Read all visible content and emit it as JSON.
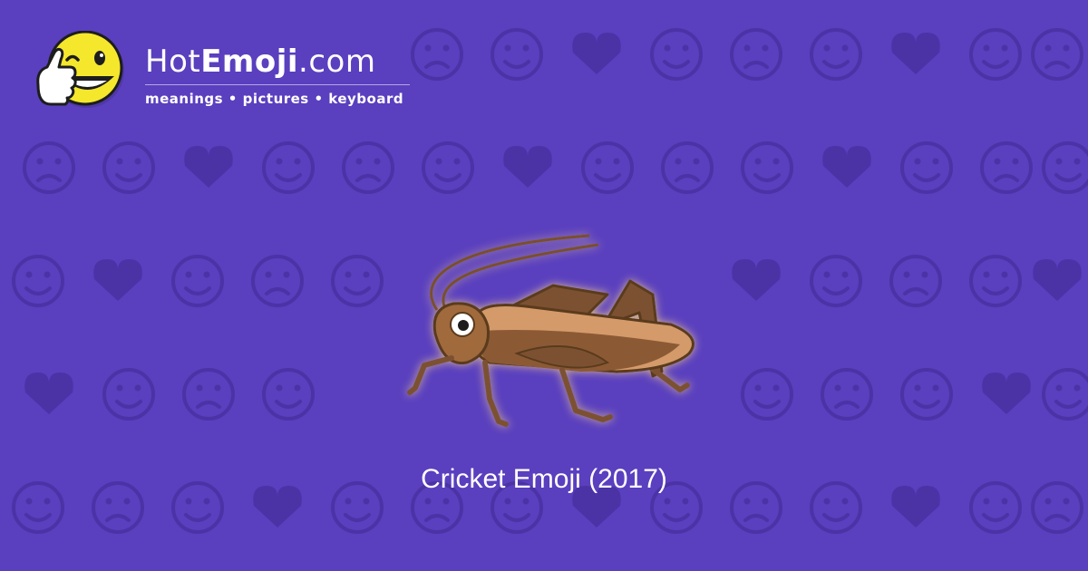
{
  "brand": {
    "name_prefix": "Hot",
    "name_strong": "Emoji",
    "name_suffix": ".com",
    "tagline": "meanings • pictures • keyboard",
    "logo_icon": "thumbs-up-winking-face-icon"
  },
  "hero": {
    "emoji_icon": "cricket-icon",
    "caption": "Cricket Emoji (2017)"
  },
  "colors": {
    "background": "#5a3fbf",
    "pattern": "#4b33a6",
    "logo_face": "#f5e72c",
    "cricket_body": "#8b5a34",
    "cricket_light": "#d49a6a"
  }
}
